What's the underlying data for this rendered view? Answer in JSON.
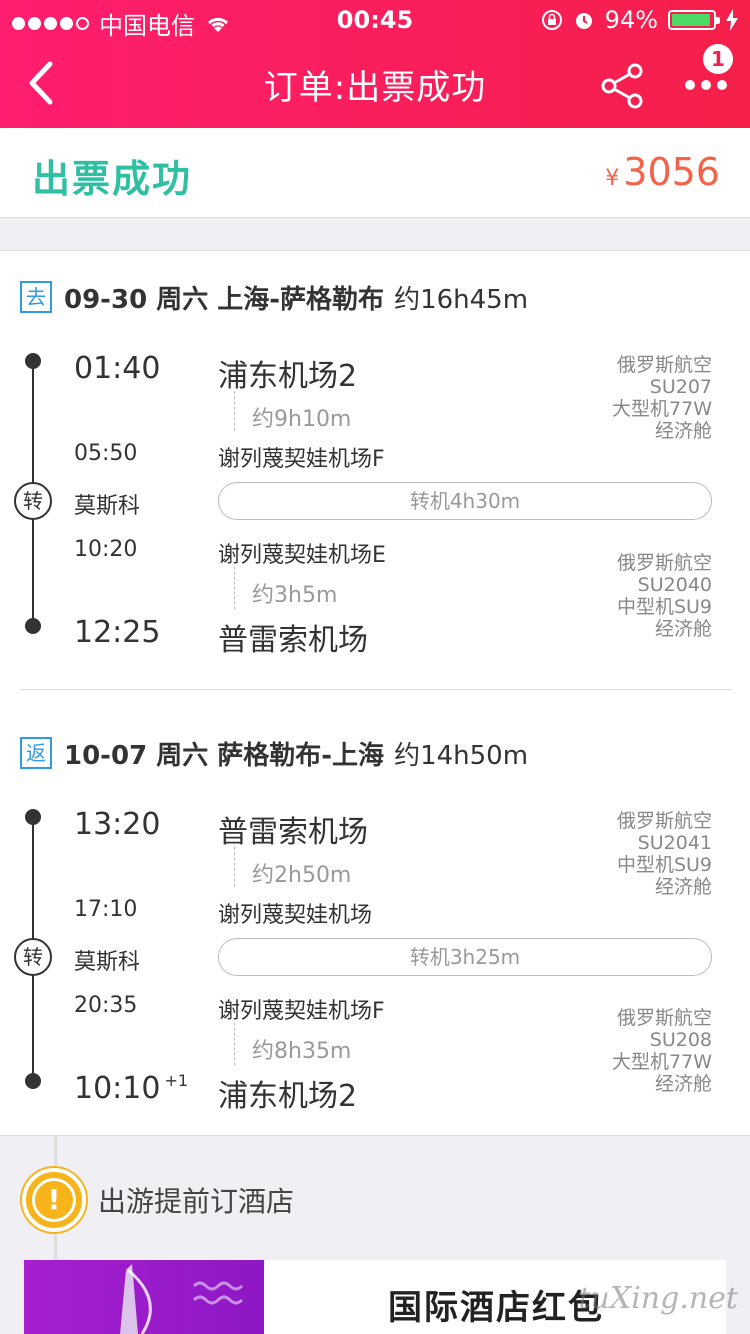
{
  "status_bar": {
    "carrier": "中国电信",
    "time": "00:45",
    "battery": "94%",
    "battery_level": 0.94
  },
  "nav": {
    "title": "订单:出票成功",
    "badge": "1"
  },
  "summary": {
    "status": "出票成功",
    "currency": "¥",
    "price": "3056"
  },
  "outbound": {
    "tag": "去",
    "header": "09-30 周六 上海-萨格勒布",
    "duration": "约16h45m",
    "dep_time": "01:40",
    "dep_airport": "浦东机场2",
    "leg1_duration": "约9h10m",
    "arr1_time": "05:50",
    "arr1_airport": "谢列蔑契娃机场F",
    "transfer_mark": "转",
    "transfer_city": "莫斯科",
    "transfer_pill": "转机4h30m",
    "dep2_time": "10:20",
    "dep2_airport": "谢列蔑契娃机场E",
    "leg2_duration": "约3h5m",
    "arr_time": "12:25",
    "arr_airport": "普雷索机场",
    "flight1": {
      "airline": "俄罗斯航空",
      "number": "SU207",
      "aircraft": "大型机77W",
      "cabin": "经济舱"
    },
    "flight2": {
      "airline": "俄罗斯航空",
      "number": "SU2040",
      "aircraft": "中型机SU9",
      "cabin": "经济舱"
    }
  },
  "return": {
    "tag": "返",
    "header": "10-07 周六 萨格勒布-上海",
    "duration": "约14h50m",
    "dep_time": "13:20",
    "dep_airport": "普雷索机场",
    "leg1_duration": "约2h50m",
    "arr1_time": "17:10",
    "arr1_airport": "谢列蔑契娃机场",
    "transfer_mark": "转",
    "transfer_city": "莫斯科",
    "transfer_pill": "转机3h25m",
    "dep2_time": "20:35",
    "dep2_airport": "谢列蔑契娃机场F",
    "leg2_duration": "约8h35m",
    "arr_time": "10:10",
    "arr_day_offset": "+1",
    "arr_airport": "浦东机场2",
    "flight1": {
      "airline": "俄罗斯航空",
      "number": "SU2041",
      "aircraft": "中型机SU9",
      "cabin": "经济舱"
    },
    "flight2": {
      "airline": "俄罗斯航空",
      "number": "SU208",
      "aircraft": "大型机77W",
      "cabin": "经济舱"
    }
  },
  "hotel": {
    "title": "出游提前订酒店",
    "promo": "国际酒店红包",
    "watermark": "tuXing.net"
  },
  "colors": {
    "header_start": "#ff1d6f",
    "header_end": "#f51f4a",
    "success": "#2fbfa3",
    "price": "#f4624a",
    "tag": "#2e9be6",
    "warning": "#f7b31a"
  }
}
